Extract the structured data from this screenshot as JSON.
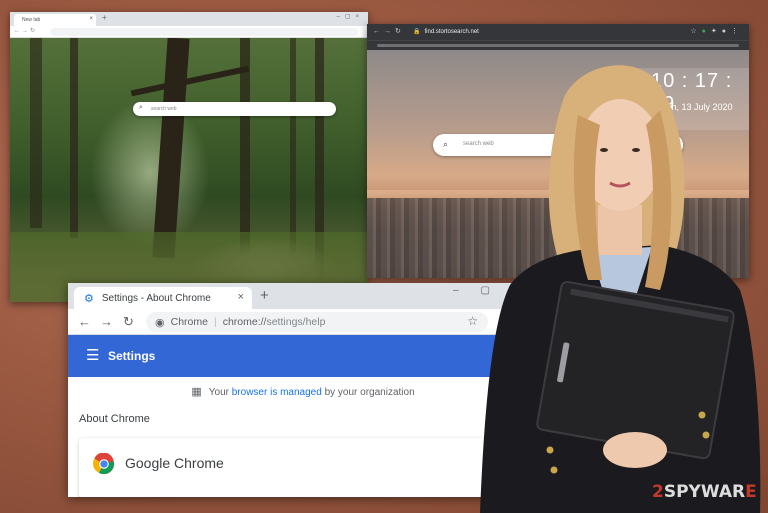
{
  "background_window_forest": {
    "tab_title": "New tab",
    "search_placeholder": "search web"
  },
  "background_window_city": {
    "url": "find.stortosearch.net",
    "clock_time": "10 : 17 : 29",
    "clock_date": "Mon, 13 July 2020",
    "search_placeholder": "search web"
  },
  "settings_window": {
    "tab_title": "Settings - About Chrome",
    "new_tab_symbol": "+",
    "omnibox_site": "Chrome",
    "omnibox_scheme": "chrome://",
    "omnibox_path": "settings/help",
    "header_title": "Settings",
    "managed_prefix": "Your",
    "managed_link": "browser is managed",
    "managed_suffix": "by your organization",
    "section_title": "About Chrome",
    "product_name": "Google Chrome"
  },
  "watermark": {
    "prefix": "2",
    "text": "SPYWAR",
    "suffix": "E"
  },
  "colors": {
    "background": "#9c5a42",
    "settings_header": "#3367d6",
    "link": "#1a73e8"
  }
}
